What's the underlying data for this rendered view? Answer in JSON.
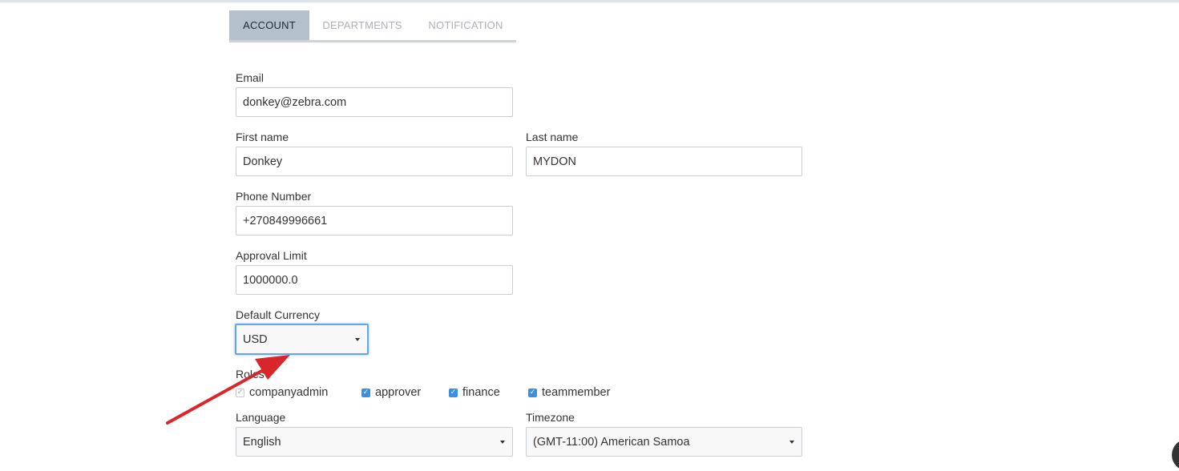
{
  "tabs": [
    {
      "label": "ACCOUNT",
      "active": true
    },
    {
      "label": "DEPARTMENTS",
      "active": false
    },
    {
      "label": "NOTIFICATION",
      "active": false
    }
  ],
  "form": {
    "email": {
      "label": "Email",
      "value": "donkey@zebra.com"
    },
    "first_name": {
      "label": "First name",
      "value": "Donkey"
    },
    "last_name": {
      "label": "Last name",
      "value": "MYDON"
    },
    "phone": {
      "label": "Phone Number",
      "value": "+270849996661"
    },
    "approval_limit": {
      "label": "Approval Limit",
      "value": "1000000.0"
    },
    "currency": {
      "label": "Default Currency",
      "value": "USD"
    },
    "roles": {
      "label": "Roles",
      "items": [
        {
          "label": "companyadmin",
          "checked": true,
          "disabled": true
        },
        {
          "label": "approver",
          "checked": true,
          "disabled": false
        },
        {
          "label": "finance",
          "checked": true,
          "disabled": false
        },
        {
          "label": "teammember",
          "checked": true,
          "disabled": false
        }
      ]
    },
    "language": {
      "label": "Language",
      "value": "English"
    },
    "timezone": {
      "label": "Timezone",
      "value": "(GMT-11:00) American Samoa"
    }
  },
  "colors": {
    "accent": "#3b8ee8",
    "tab_active_bg": "#b5c0cd",
    "annotation_arrow": "#d9262b"
  },
  "icons": {
    "checkmark": "check-icon",
    "dropdown": "caret-down-icon",
    "annotation": "red-arrow-icon"
  }
}
